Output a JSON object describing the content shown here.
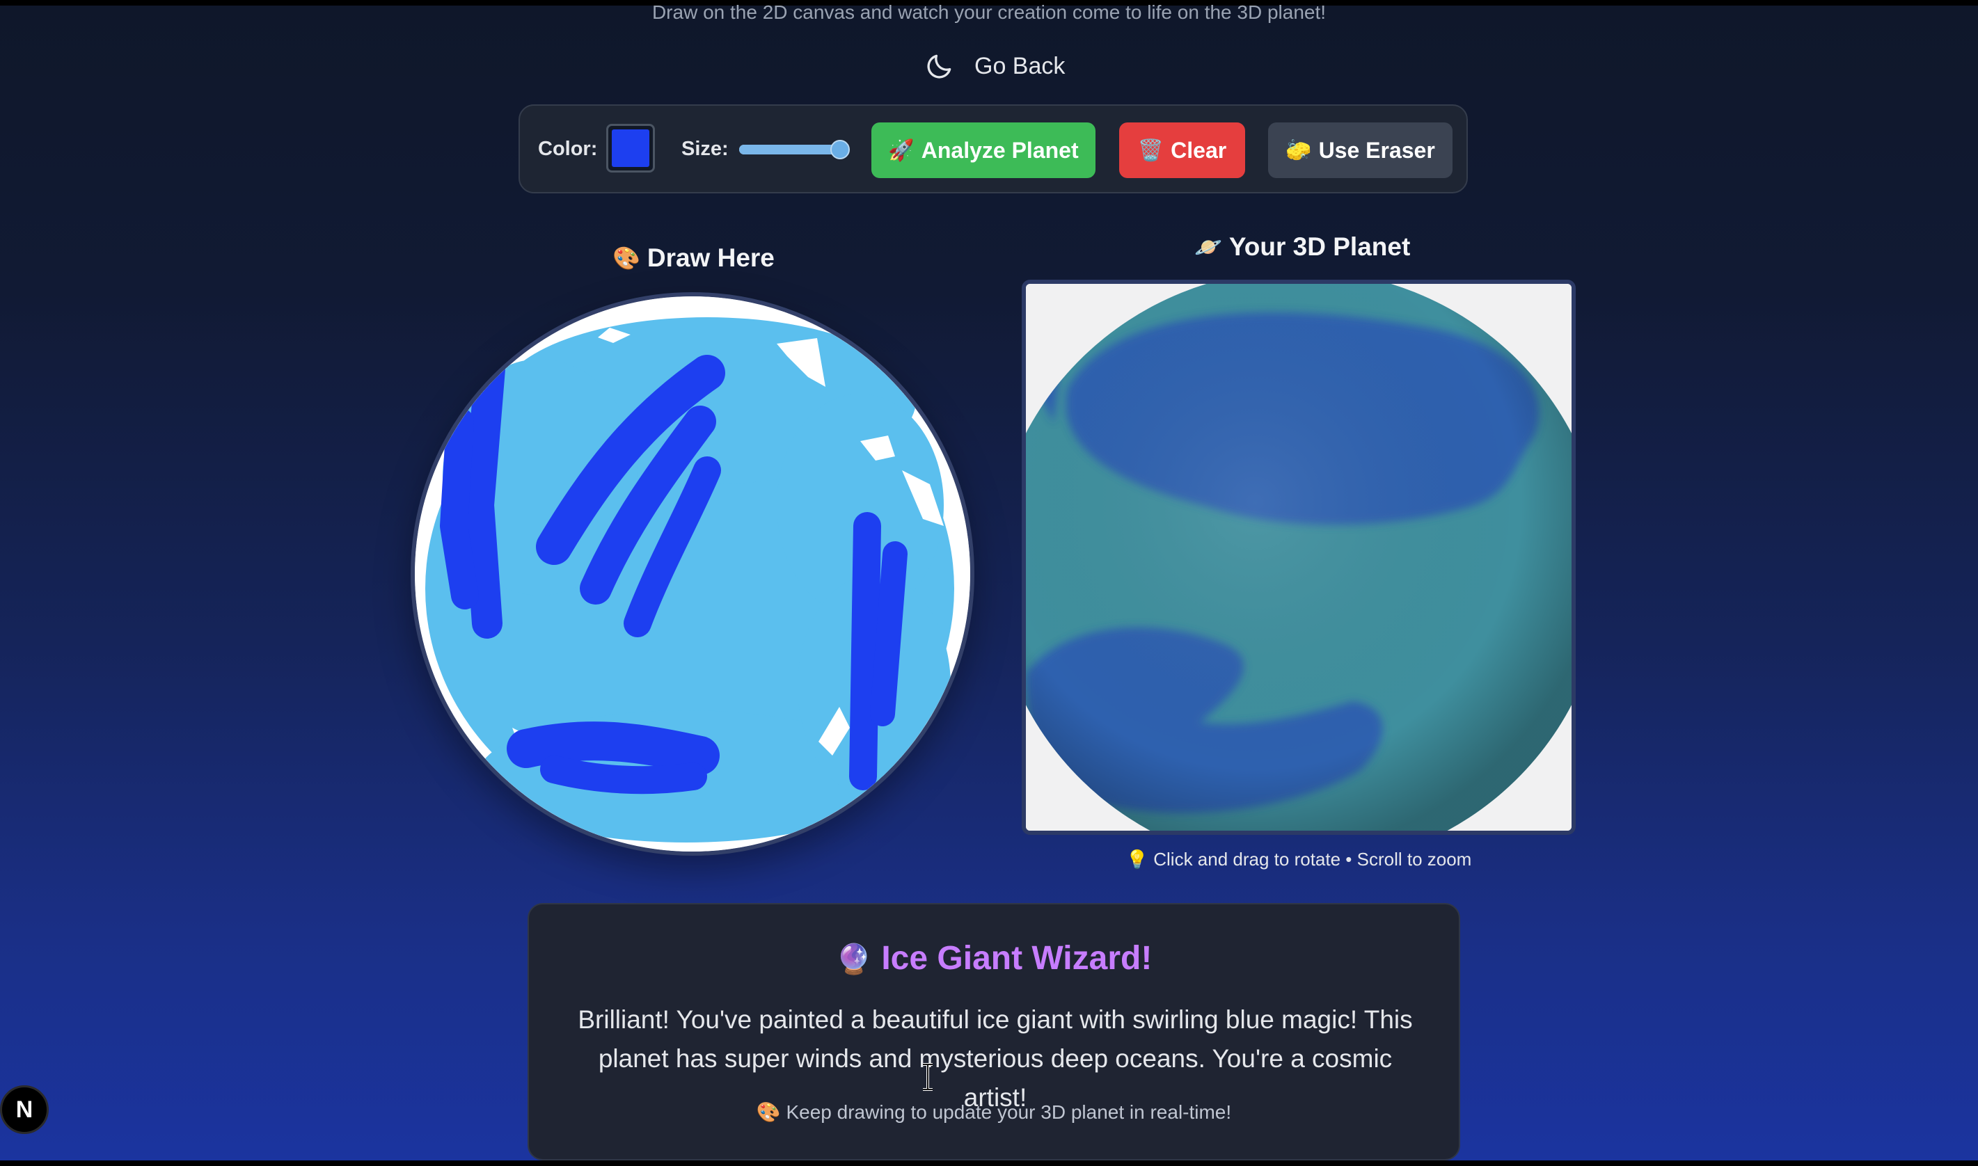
{
  "header": {
    "subtitle": "Draw on the 2D canvas and watch your creation come to life on the 3D planet!",
    "go_back_label": "Go Back",
    "go_back_icon": "moon-icon"
  },
  "toolbar": {
    "color_label": "Color:",
    "color_value": "#1d3ff0",
    "size_label": "Size:",
    "size_fraction": 0.92,
    "analyze_emoji": "🚀",
    "analyze_label": "Analyze Planet",
    "clear_emoji": "🗑️",
    "clear_label": "Clear",
    "eraser_emoji": "🧽",
    "eraser_label": "Use Eraser"
  },
  "draw_panel": {
    "title_emoji": "🎨",
    "title": "Draw Here"
  },
  "planet_panel": {
    "title_emoji": "🪐",
    "title": "Your 3D Planet",
    "hint": "💡 Click and drag to rotate • Scroll to zoom"
  },
  "result": {
    "title_emoji": "🔮",
    "title": "Ice Giant Wizard!",
    "text": "Brilliant! You've painted a beautiful ice giant with swirling blue magic! This planet has super winds and mysterious deep oceans. You're a cosmic artist!",
    "footer": "🎨 Keep drawing to update your 3D planet in real-time!"
  },
  "badge": {
    "letter": "N"
  },
  "colors": {
    "ice": "#5bbfee",
    "brush": "#1d3ff0",
    "planet_ocean": "#3f8f9e",
    "planet_band": "#2e5fb0",
    "analyze": "#3dbb57",
    "clear": "#e53e3e",
    "eraser": "#3b4352",
    "result_title": "#c77dff"
  }
}
